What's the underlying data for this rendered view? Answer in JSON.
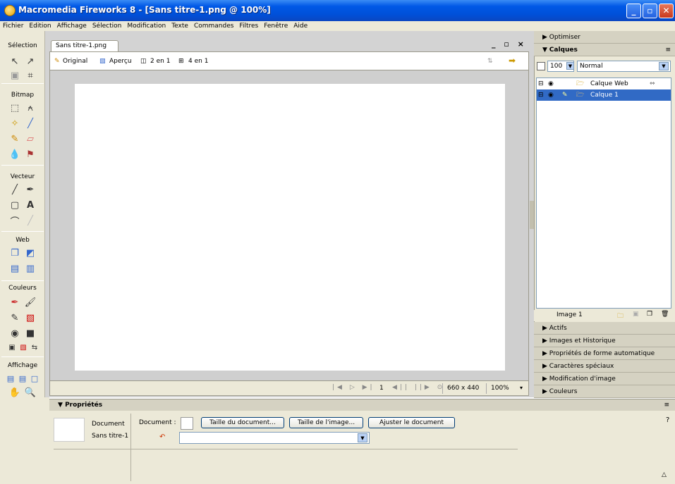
{
  "window": {
    "title": "Macromedia Fireworks 8 - [Sans titre-1.png @ 100%]",
    "min_label": "_",
    "max_label": "▫",
    "close_label": "✕"
  },
  "menu": [
    "Fichier",
    "Edition",
    "Affichage",
    "Sélection",
    "Modification",
    "Texte",
    "Commandes",
    "Filtres",
    "Fenêtre",
    "Aide"
  ],
  "toolbox": {
    "sections": [
      "Sélection",
      "Bitmap",
      "Vecteur",
      "Web",
      "Couleurs",
      "Affichage"
    ]
  },
  "document": {
    "tab_label": "Sans titre-1.png",
    "controls": "_ ▫ ×",
    "views": {
      "original": "Original",
      "preview": "Aperçu",
      "two_up": "2 en 1",
      "four_up": "4 en 1"
    },
    "status": {
      "frame": "1",
      "size": "660 x 440",
      "zoom": "100%"
    }
  },
  "panels": {
    "optimiser": "Optimiser",
    "calques": "Calques",
    "opacity": "100",
    "blend_mode": "Normal",
    "layers": [
      {
        "name": "Calque Web"
      },
      {
        "name": "Calque 1"
      }
    ],
    "frame_label": "Image 1",
    "collapsed": [
      "Actifs",
      "Images et Historique",
      "Propriétés de forme automatique",
      "Caractères spéciaux",
      "Modification d'image",
      "Couleurs"
    ]
  },
  "properties": {
    "title": "Propriétés",
    "doc_type": "Document",
    "doc_name": "Sans titre-1",
    "doc_label": "Document :",
    "btn_canvas_size": "Taille du document...",
    "btn_image_size": "Taille de l'image...",
    "btn_fit": "Ajuster le document",
    "help": "?"
  },
  "colors": {
    "titlebar": "#0058e6",
    "chrome": "#ece9d8",
    "selection": "#316ac5"
  }
}
